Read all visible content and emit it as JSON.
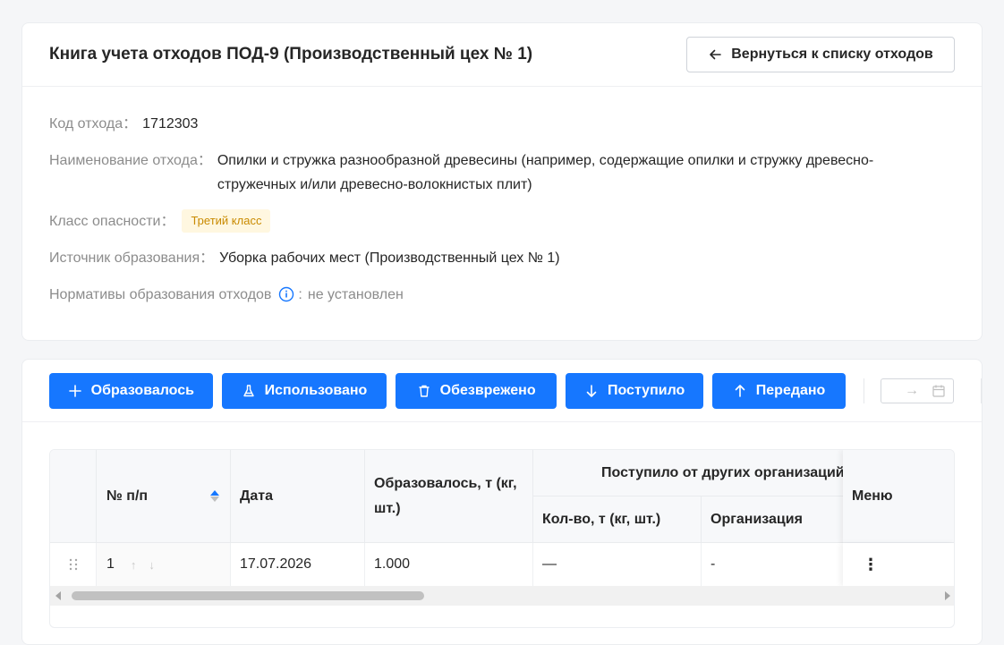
{
  "header": {
    "title": "Книга учета отходов ПОД-9 (Производственный цех № 1)",
    "back_label": "Вернуться к списку отходов"
  },
  "fields": {
    "code": {
      "label": "Код отхода：",
      "value": "1712303"
    },
    "name": {
      "label": "Наименование отхода：",
      "value": "Опилки и стружка разнообразной древесины (например, содержащие опилки и стружку древесно-стружечных и/или древесно-волокнистых плит)"
    },
    "hazard": {
      "label": "Класс опасности：",
      "value": "Третий класс"
    },
    "source": {
      "label": "Источник образования：",
      "value": "Уборка рабочих мест (Производственный цех № 1)"
    },
    "norms": {
      "label": "Нормативы образования отходов",
      "value": "не установлен"
    }
  },
  "toolbar": {
    "formed": "Образовалось",
    "used": "Использовано",
    "neutralized": "Обезврежено",
    "received": "Поступило",
    "transferred": "Передано",
    "date_arrow": "→"
  },
  "table": {
    "headers": {
      "num": "№ п/п",
      "date": "Дата",
      "formed": "Образовалось, т (кг, шт.)",
      "received_group": "Поступило от других организаций",
      "qty": "Кол-во, т (кг, шт.)",
      "org": "Организация",
      "menu": "Меню"
    },
    "rows": [
      {
        "num": "1",
        "date": "17.07.2026",
        "formed": "1.000",
        "qty": "—",
        "org": "-",
        "menu": "⋮"
      }
    ]
  },
  "colors": {
    "primary": "#1677ff",
    "badge_bg": "#fff7e0",
    "badge_text": "#c98a00"
  }
}
